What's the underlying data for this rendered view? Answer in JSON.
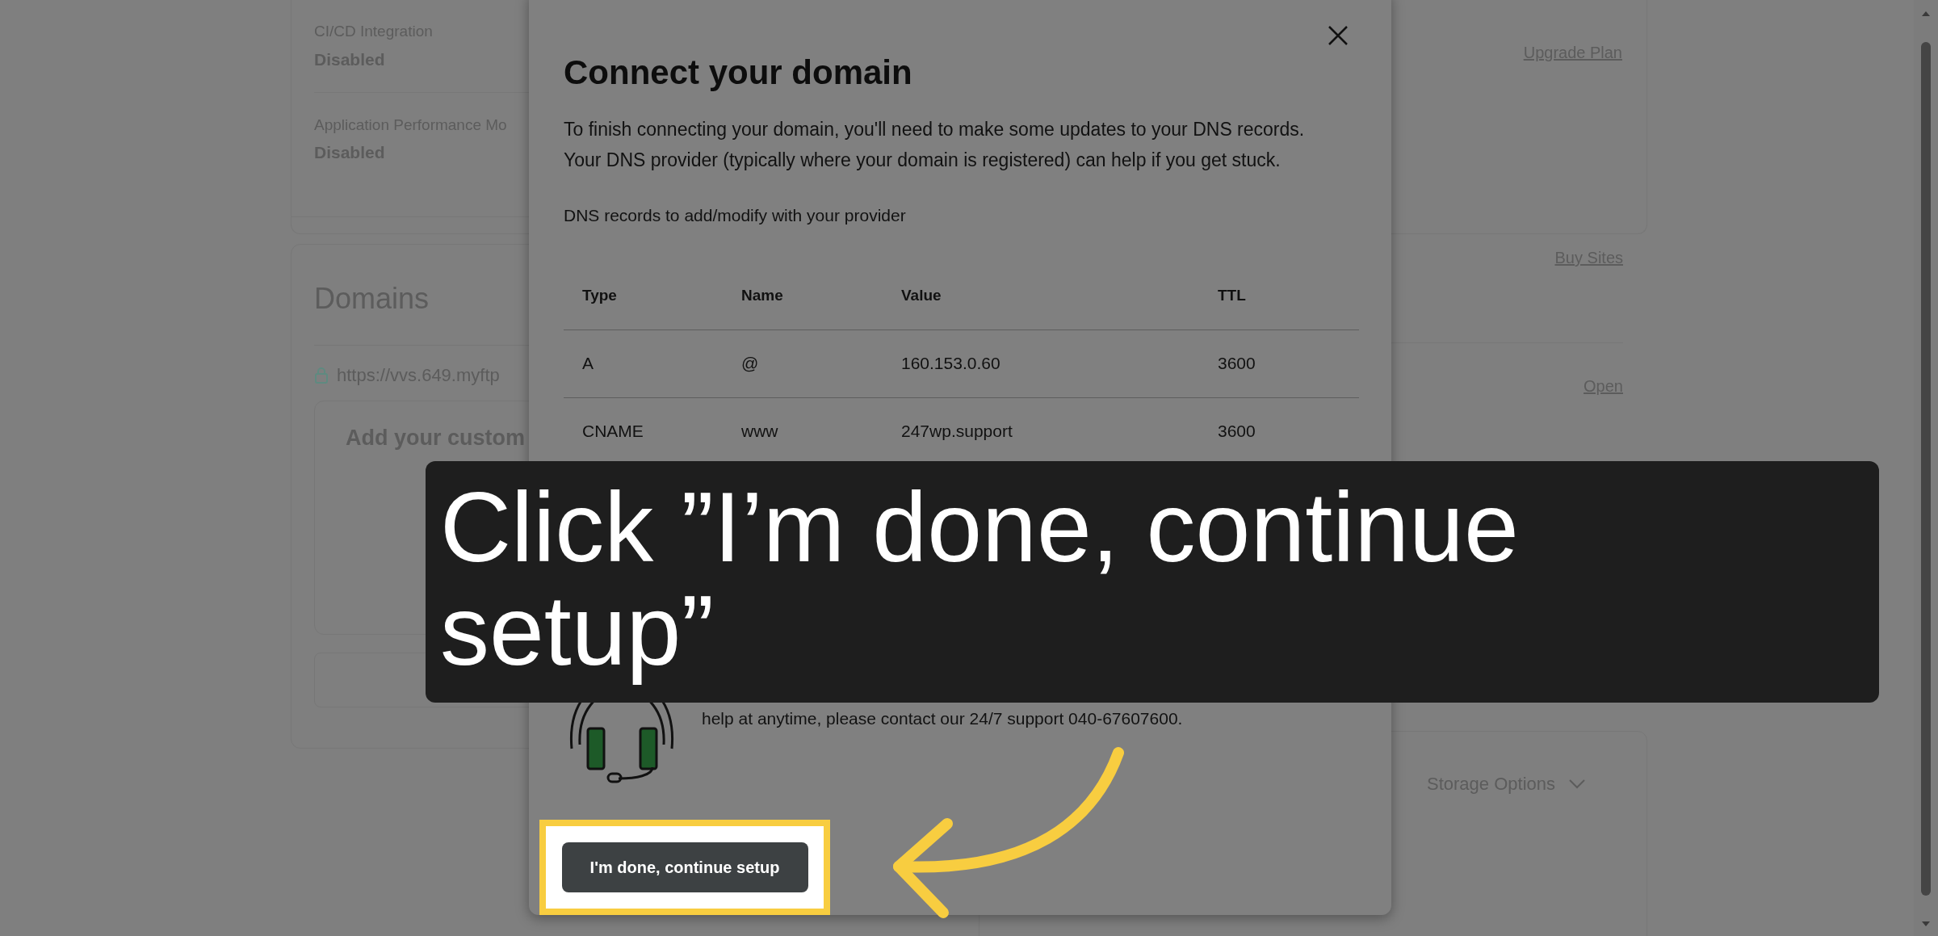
{
  "page": {
    "settings": [
      {
        "label": "CI/CD Integration",
        "value": "Disabled"
      },
      {
        "label": "Application Performance Mo",
        "value": "Disabled"
      }
    ],
    "upgrade_link": "Upgrade Plan",
    "buy_link": "Buy Sites",
    "domains": {
      "title": "Domains",
      "url": "https://vvs.649.myftp",
      "open_link": "Open",
      "custom_card_title": "Add your custom"
    },
    "storage_options": "Storage Options"
  },
  "dialog": {
    "title": "Connect your domain",
    "intro": "To finish connecting your domain, you'll need to make some updates to your DNS records. Your DNS provider (typically where your domain is registered) can help if you get stuck.",
    "records_label": "DNS records to add/modify with your provider",
    "table": {
      "columns": [
        "Type",
        "Name",
        "Value",
        "TTL"
      ],
      "rows": [
        [
          "A",
          "@",
          "160.153.0.60",
          "3600"
        ],
        [
          "CNAME",
          "www",
          "247wp.support",
          "3600"
        ]
      ]
    },
    "help_text": "help at anytime, please contact our 24/7 support 040-67607600.",
    "button": "I'm done, continue setup"
  },
  "tutorial": {
    "caption": "Click ”I’m done, continue setup”"
  }
}
